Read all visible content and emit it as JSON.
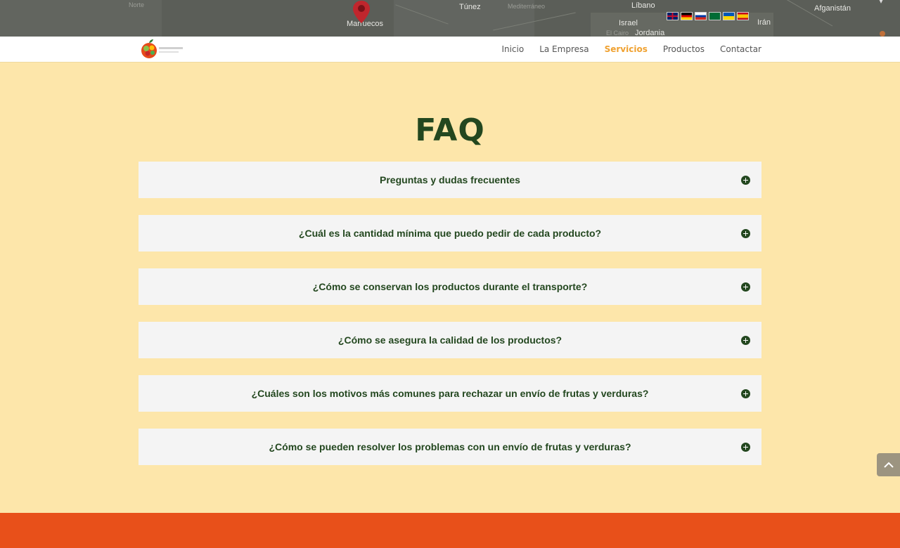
{
  "map": {
    "labels": {
      "norte": "Norte",
      "tunez": "Túnez",
      "mediterraneo": "Mediterráneo",
      "libano": "Líbano",
      "afganistan": "Afganistán",
      "marruecos": "Marruecos",
      "israel": "Israel",
      "iran": "Irán",
      "cairo": "El Cairo",
      "jordania": "Jordania"
    },
    "languages": [
      "English",
      "Deutsch",
      "Русский",
      "العربية",
      "Українська",
      "Español"
    ]
  },
  "header": {
    "logo_alt": "Logo",
    "nav": {
      "inicio": "Inicio",
      "empresa": "La Empresa",
      "servicios": "Servicios",
      "productos": "Productos",
      "contactar": "Contactar"
    }
  },
  "faq": {
    "title": "FAQ",
    "items": [
      {
        "question": "Preguntas y dudas frecuentes"
      },
      {
        "question": "¿Cuál es la cantidad mínima que puedo pedir de cada producto?"
      },
      {
        "question": "¿Cómo se conservan los productos durante el transporte?"
      },
      {
        "question": "¿Cómo se asegura la calidad de los productos?"
      },
      {
        "question": "¿Cuáles son los motivos más comunes para rechazar un envío de frutas y verduras?"
      },
      {
        "question": "¿Cómo se pueden resolver los problemas con un envío de frutas y verduras?"
      }
    ]
  },
  "colors": {
    "page_bg": "#fde6aa",
    "title_green": "#23471f",
    "nav_active": "#f0a130",
    "footer_orange": "#e8501a",
    "faq_item_bg": "#f4f4f4"
  },
  "icons": {
    "map_pin": "map-pin-icon",
    "toggle": "plus-circle-icon",
    "scroll_top": "chevron-up-icon"
  }
}
